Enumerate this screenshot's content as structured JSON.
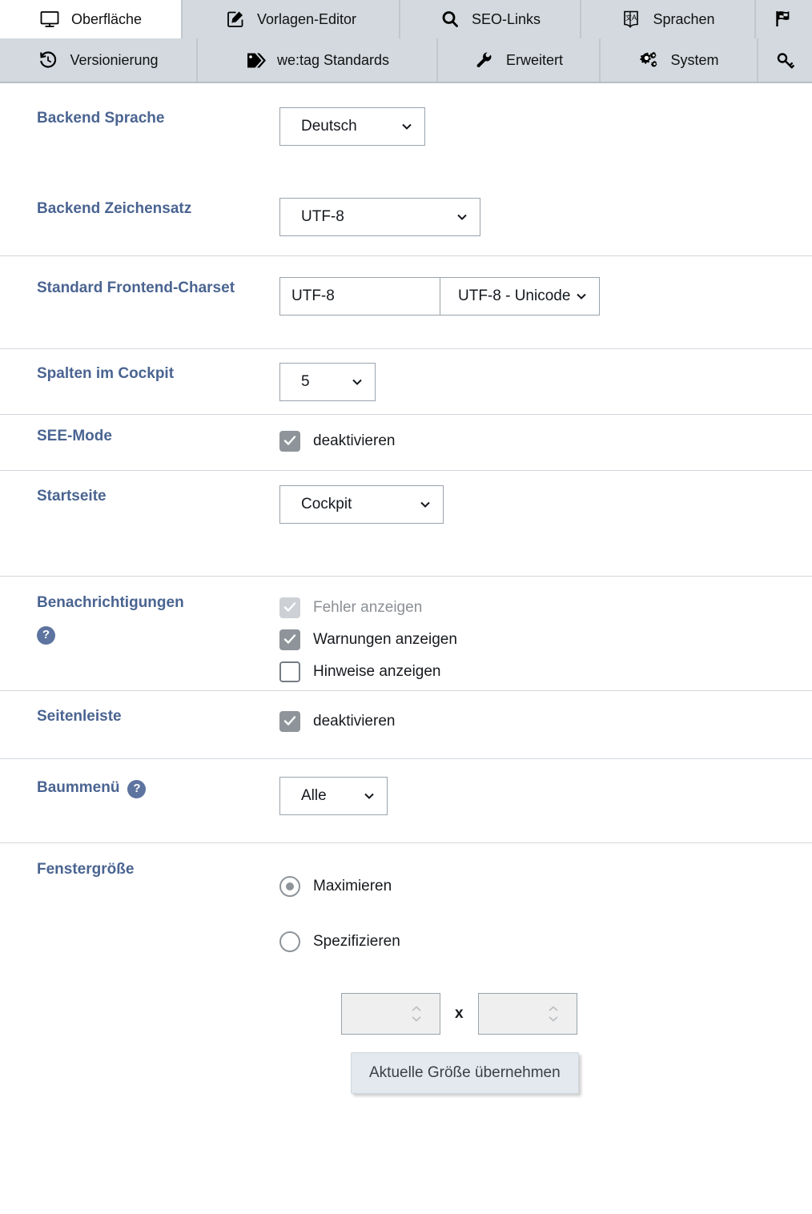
{
  "tabs": {
    "row1": [
      {
        "label": "Oberfläche",
        "icon": "monitor-icon",
        "active": true
      },
      {
        "label": "Vorlagen-Editor",
        "icon": "edit-square-icon",
        "active": false
      },
      {
        "label": "SEO-Links",
        "icon": "search-icon",
        "active": false
      },
      {
        "label": "Sprachen",
        "icon": "translate-icon",
        "active": false
      },
      {
        "label": "",
        "icon": "flag-icon",
        "active": false
      }
    ],
    "row2": [
      {
        "label": "Versionierung",
        "icon": "history-icon",
        "active": false
      },
      {
        "label": "we:tag Standards",
        "icon": "tag-icon",
        "active": false
      },
      {
        "label": "Erweitert",
        "icon": "wrench-icon",
        "active": false
      },
      {
        "label": "System",
        "icon": "gears-icon",
        "active": false
      },
      {
        "label": "",
        "icon": "key-icon",
        "active": false
      }
    ]
  },
  "form": {
    "backend_language": {
      "label": "Backend Sprache",
      "value": "Deutsch"
    },
    "backend_charset": {
      "label": "Backend Zeichensatz",
      "value": "UTF-8"
    },
    "frontend_charset": {
      "label": "Standard Frontend-Charset",
      "input_value": "UTF-8",
      "select_value": "UTF-8 - Unicode"
    },
    "cockpit_columns": {
      "label": "Spalten im Cockpit",
      "value": "5"
    },
    "see_mode": {
      "label": "SEE-Mode",
      "option_label": "deaktivieren",
      "checked": true
    },
    "start_page": {
      "label": "Startseite",
      "value": "Cockpit"
    },
    "notifications": {
      "label": "Benachrichtigungen",
      "help": "?",
      "options": [
        {
          "label": "Fehler anzeigen",
          "checked": true,
          "disabled": true
        },
        {
          "label": "Warnungen anzeigen",
          "checked": true,
          "disabled": false
        },
        {
          "label": "Hinweise anzeigen",
          "checked": false,
          "disabled": false
        }
      ]
    },
    "sidebar": {
      "label": "Seitenleiste",
      "option_label": "deaktivieren",
      "checked": true
    },
    "tree_menu": {
      "label": "Baummenü",
      "help": "?",
      "value": "Alle"
    },
    "window_size": {
      "label": "Fenstergröße",
      "options": [
        {
          "label": "Maximieren",
          "selected": true
        },
        {
          "label": "Spezifizieren",
          "selected": false
        }
      ],
      "width_value": "",
      "height_value": "",
      "separator": "x",
      "apply_label": "Aktuelle Größe übernehmen"
    }
  },
  "colors": {
    "label_blue": "#4a6491",
    "tabbar_bg": "#d3d9de",
    "active_tab_bg": "#ffffff",
    "checkbox_gray": "#8e9499",
    "help_badge": "#5d74a0",
    "button_bg": "#e3e9ee",
    "separator": "#d2d7dc"
  }
}
